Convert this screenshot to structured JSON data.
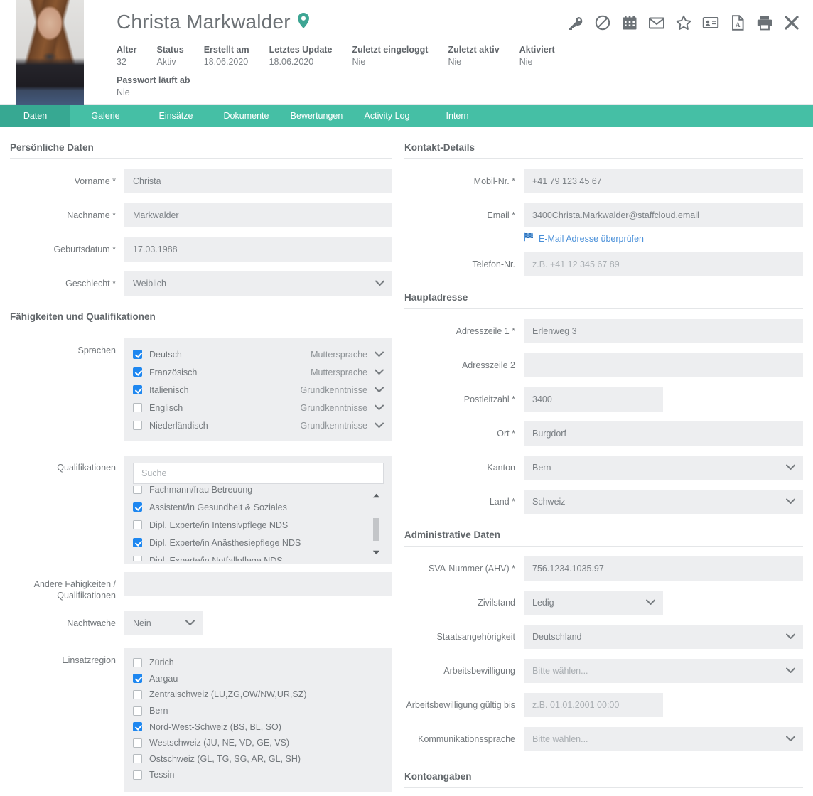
{
  "header": {
    "name": "Christa Markwalder",
    "pin_icon": "map-pin-icon",
    "meta": [
      {
        "label": "Alter",
        "value": "32"
      },
      {
        "label": "Status",
        "value": "Aktiv"
      },
      {
        "label": "Erstellt am",
        "value": "18.06.2020"
      },
      {
        "label": "Letztes Update",
        "value": "18.06.2020"
      },
      {
        "label": "Zuletzt eingeloggt",
        "value": "Nie"
      },
      {
        "label": "Zuletzt aktiv",
        "value": "Nie"
      },
      {
        "label": "Aktiviert",
        "value": "Nie"
      }
    ],
    "meta2": {
      "label": "Passwort läuft ab",
      "value": "Nie"
    },
    "icons": [
      "key-icon",
      "ban-icon",
      "calendar-icon",
      "envelope-icon",
      "star-icon",
      "id-card-icon",
      "pdf-file-icon",
      "printer-icon",
      "close-icon"
    ]
  },
  "tabs": [
    {
      "label": "Daten",
      "active": true
    },
    {
      "label": "Galerie",
      "active": false
    },
    {
      "label": "Einsätze",
      "active": false
    },
    {
      "label": "Dokumente",
      "active": false
    },
    {
      "label": "Bewertungen",
      "active": false
    },
    {
      "label": "Activity Log",
      "active": false
    },
    {
      "label": "Intern",
      "active": false
    }
  ],
  "left": {
    "personal": {
      "title": "Persönliche Daten",
      "vorname": {
        "label": "Vorname *",
        "value": "Christa"
      },
      "nachname": {
        "label": "Nachname *",
        "value": "Markwalder"
      },
      "geburtsdatum": {
        "label": "Geburtsdatum *",
        "value": "17.03.1988"
      },
      "geschlecht": {
        "label": "Geschlecht *",
        "value": "Weiblich"
      }
    },
    "skills": {
      "title": "Fähigkeiten und Qualifikationen",
      "sprachen_label": "Sprachen",
      "sprachen": [
        {
          "name": "Deutsch",
          "checked": true,
          "level": "Muttersprache"
        },
        {
          "name": "Französisch",
          "checked": true,
          "level": "Muttersprache"
        },
        {
          "name": "Italienisch",
          "checked": true,
          "level": "Grundkenntnisse"
        },
        {
          "name": "Englisch",
          "checked": false,
          "level": "Grundkenntnisse"
        },
        {
          "name": "Niederländisch",
          "checked": false,
          "level": "Grundkenntnisse"
        }
      ],
      "qualifikationen_label": "Qualifikationen",
      "qual_search_placeholder": "Suche",
      "qual_search_value": "",
      "qualifikationen": [
        {
          "name": "Fachmann/frau Betreuung",
          "checked": false
        },
        {
          "name": "Assistent/in Gesundheit & Soziales",
          "checked": true
        },
        {
          "name": "Dipl. Experte/in Intensivpflege NDS",
          "checked": false
        },
        {
          "name": "Dipl. Experte/in Anästhesiepflege NDS",
          "checked": true
        },
        {
          "name": "Dipl. Experte/in Notfallpflege NDS",
          "checked": false
        }
      ],
      "andere_label": "Andere Fähigkeiten / Qualifikationen",
      "andere_value": "",
      "nachtwache_label": "Nachtwache",
      "nachtwache_value": "Nein",
      "einsatzregion_label": "Einsatzregion",
      "einsatzregion": [
        {
          "name": "Zürich",
          "checked": false
        },
        {
          "name": "Aargau",
          "checked": true
        },
        {
          "name": "Zentralschweiz (LU,ZG,OW/NW,UR,SZ)",
          "checked": false
        },
        {
          "name": "Bern",
          "checked": false
        },
        {
          "name": "Nord-West-Schweiz (BS, BL, SO)",
          "checked": true
        },
        {
          "name": "Westschweiz (JU, NE, VD, GE, VS)",
          "checked": false
        },
        {
          "name": "Ostschweiz (GL, TG, SG, AR, GL, SH)",
          "checked": false
        },
        {
          "name": "Tessin",
          "checked": false
        }
      ]
    }
  },
  "right": {
    "contact": {
      "title": "Kontakt-Details",
      "mobil": {
        "label": "Mobil-Nr. *",
        "value": "+41 79 123 45 67"
      },
      "email": {
        "label": "Email *",
        "value": "3400Christa.Markwalder@staffcloud.email"
      },
      "verify_link": "E-Mail Adresse überprüfen",
      "verify_icon": "flag-icon",
      "telefon": {
        "label": "Telefon-Nr.",
        "value": "",
        "placeholder": "z.B. +41 12 345 67 89"
      }
    },
    "address": {
      "title": "Hauptadresse",
      "adr1": {
        "label": "Adresszeile 1 *",
        "value": "Erlenweg 3"
      },
      "adr2": {
        "label": "Adresszeile 2",
        "value": ""
      },
      "plz": {
        "label": "Postleitzahl *",
        "value": "3400"
      },
      "ort": {
        "label": "Ort *",
        "value": "Burgdorf"
      },
      "kanton": {
        "label": "Kanton",
        "value": "Bern"
      },
      "land": {
        "label": "Land *",
        "value": "Schweiz"
      }
    },
    "admin": {
      "title": "Administrative Daten",
      "sva": {
        "label": "SVA-Nummer (AHV) *",
        "value": "756.1234.1035.97"
      },
      "zivil": {
        "label": "Zivilstand",
        "value": "Ledig"
      },
      "staat": {
        "label": "Staatsangehörigkeit",
        "value": "Deutschland"
      },
      "arbeit": {
        "label": "Arbeitsbewilligung",
        "value": "Bitte wählen..."
      },
      "arbeit_bis": {
        "label": "Arbeitsbewilligung gültig bis",
        "value": "",
        "placeholder": "z.B. 01.01.2001 00:00"
      },
      "komm": {
        "label": "Kommunikationssprache",
        "value": "Bitte wählen..."
      }
    },
    "konto": {
      "title": "Kontoangaben"
    }
  },
  "colors": {
    "accent": "#45bfa5",
    "accent_active": "#37a892",
    "field_bg": "#edeef0",
    "checkbox_on": "#1e87f0",
    "link": "#4a90d9"
  }
}
